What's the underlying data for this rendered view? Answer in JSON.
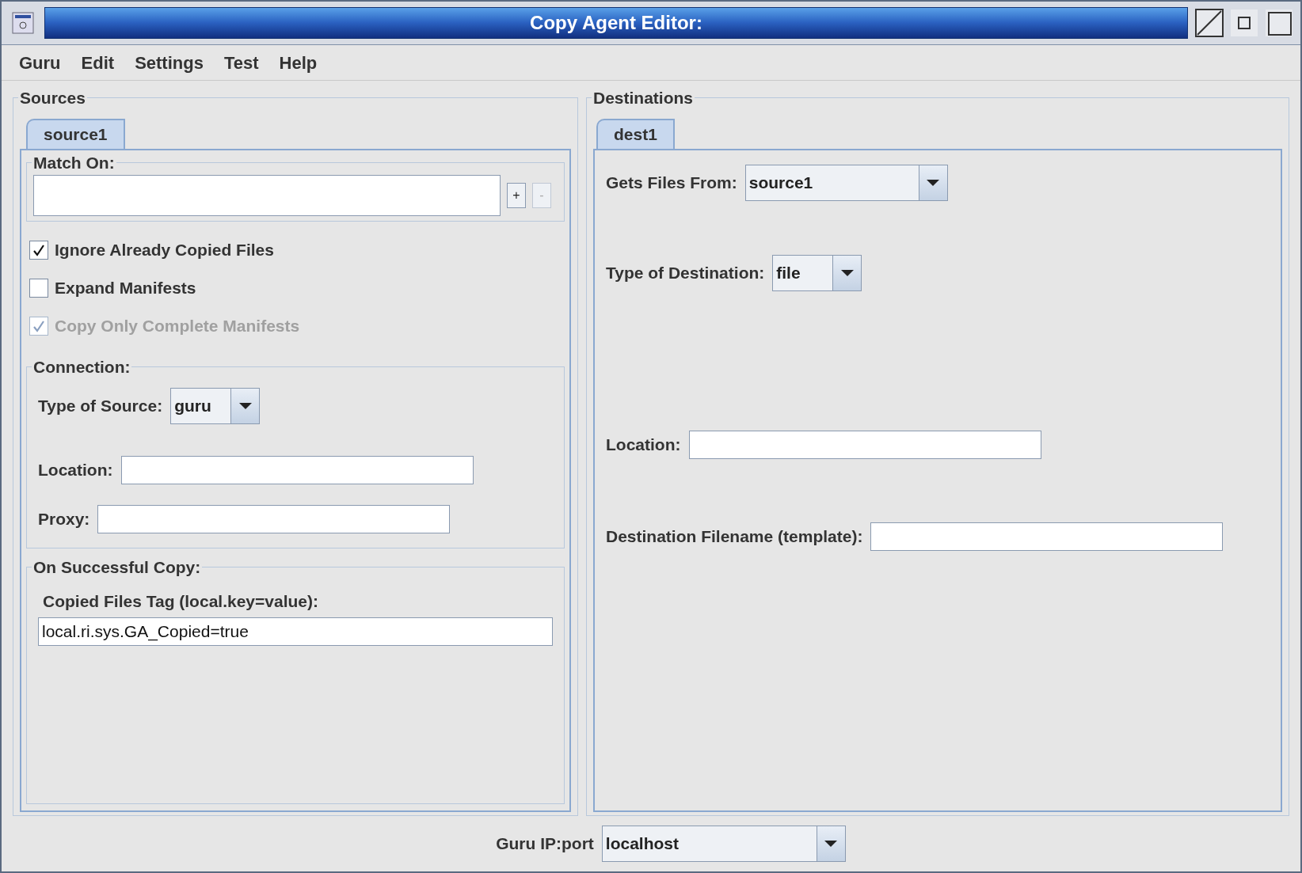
{
  "window": {
    "title": "Copy Agent Editor:"
  },
  "menu": [
    "Guru",
    "Edit",
    "Settings",
    "Test",
    "Help"
  ],
  "sources": {
    "title": "Sources",
    "tabs": [
      {
        "label": "source1",
        "selected": true
      }
    ],
    "match_on": {
      "title": "Match On:",
      "buttons": [
        {
          "label": "+",
          "disabled": false
        },
        {
          "label": "-",
          "disabled": true
        }
      ]
    },
    "options": [
      {
        "label": "Ignore Already Copied Files",
        "checked": true,
        "disabled": false
      },
      {
        "label": "Expand Manifests",
        "checked": false,
        "disabled": false
      },
      {
        "label": "Copy Only Complete Manifests",
        "checked": true,
        "disabled": true
      }
    ],
    "connection": {
      "title": "Connection:",
      "type_label": "Type of Source:",
      "type_value": "guru",
      "location_label": "Location:",
      "proxy_label": "Proxy:"
    },
    "on_success": {
      "title": "On Successful Copy:",
      "tag_label": "Copied Files Tag (local.key=value):",
      "tag_value": "local.ri.sys.GA_Copied=true"
    }
  },
  "destinations": {
    "title": "Destinations",
    "tabs": [
      {
        "label": "dest1",
        "selected": true
      }
    ],
    "gets_from_label": "Gets Files From:",
    "gets_from_value": "source1",
    "type_label": "Type of Destination:",
    "type_value": "file",
    "location_label": "Location:",
    "filename_label": "Destination Filename (template):"
  },
  "footer": {
    "label": "Guru IP:port",
    "value": "localhost"
  }
}
